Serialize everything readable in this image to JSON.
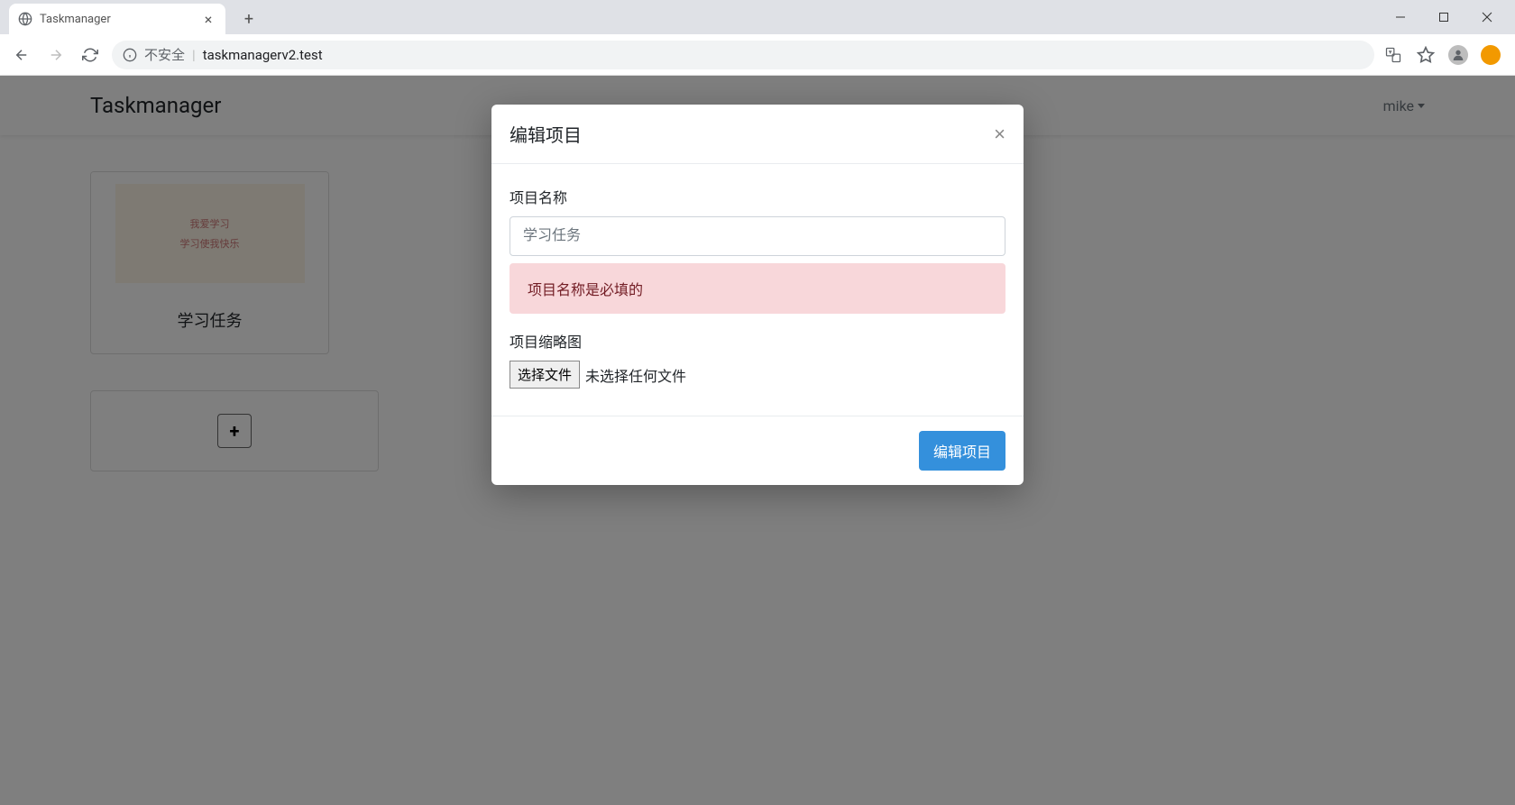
{
  "browser": {
    "tab_title": "Taskmanager",
    "insecure_label": "不安全",
    "url": "taskmanagerv2.test"
  },
  "navbar": {
    "brand": "Taskmanager",
    "user": "mike"
  },
  "cards": {
    "project_title": "学习任务",
    "thumbnail_text_line1": "我爱学习",
    "thumbnail_text_line2": "学习使我快乐",
    "add_label": "+"
  },
  "modal": {
    "title": "编辑项目",
    "fields": {
      "name_label": "项目名称",
      "name_placeholder": "学习任务",
      "name_error": "项目名称是必填的",
      "thumbnail_label": "项目缩略图",
      "file_button": "选择文件",
      "file_status": "未选择任何文件"
    },
    "submit": "编辑项目"
  }
}
